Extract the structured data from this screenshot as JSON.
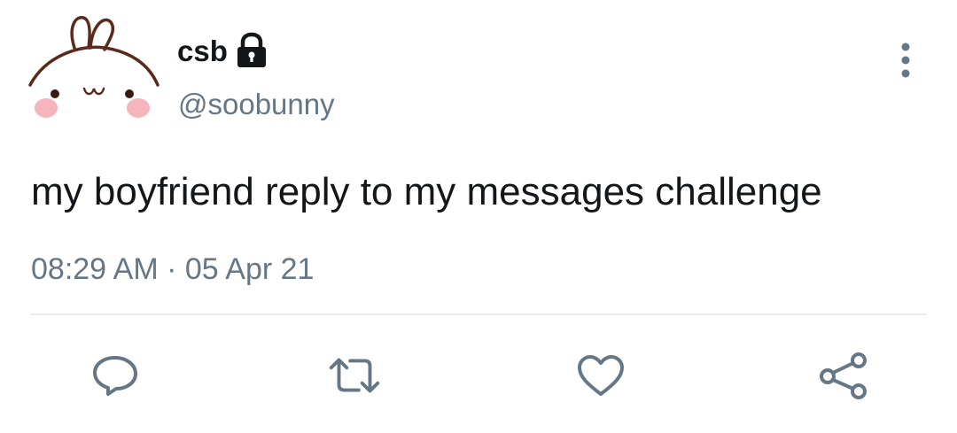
{
  "tweet": {
    "display_name": "csb",
    "handle": "@soobunny",
    "text": "my boyfriend reply to my messages challenge",
    "time": "08:29 AM",
    "separator": "·",
    "date": "05 Apr 21",
    "protected": true
  },
  "icons": {
    "avatar": "bunny-avatar",
    "lock": "lock-icon",
    "more": "more-vertical-icon",
    "reply": "reply-icon",
    "retweet": "retweet-icon",
    "like": "heart-icon",
    "share": "share-icon"
  },
  "colors": {
    "text_primary": "#14171a",
    "text_secondary": "#657786",
    "divider": "#e6ecf0",
    "icon": "#657786"
  }
}
